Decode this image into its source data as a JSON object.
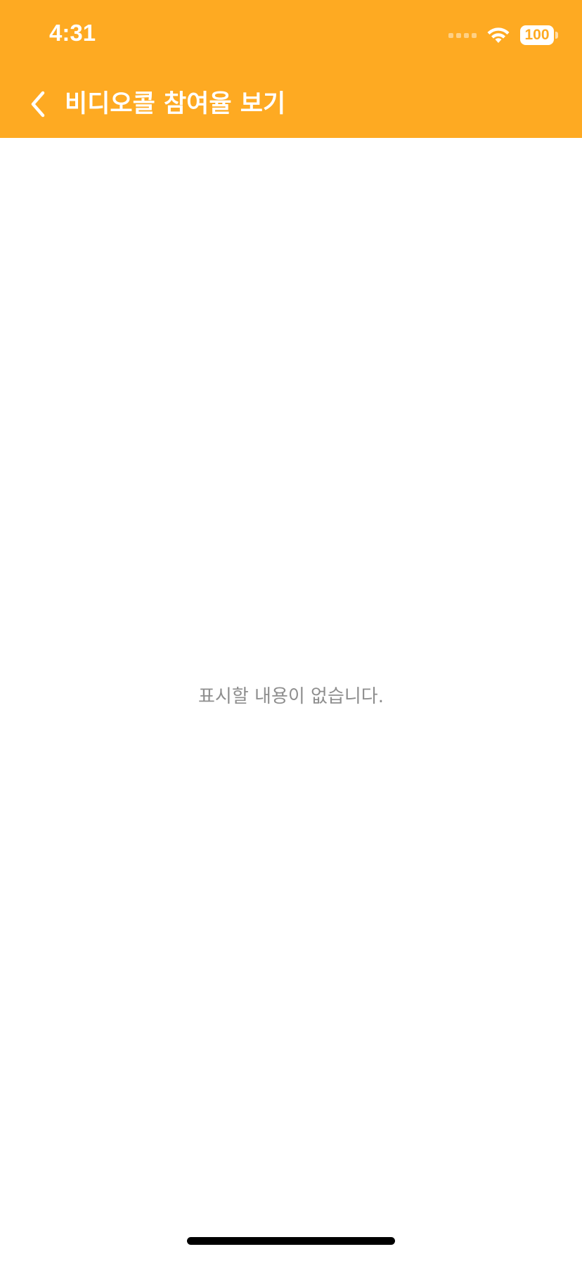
{
  "status_bar": {
    "time": "4:31",
    "battery": "100"
  },
  "nav": {
    "title": "비디오콜 참여율 보기"
  },
  "content": {
    "empty_message": "표시할 내용이 없습니다."
  },
  "colors": {
    "header": "#FEAA22",
    "background": "#FFFFFF",
    "empty_text": "#8E8E8E"
  },
  "icons": {
    "back": "chevron-left-icon",
    "wifi": "wifi-icon",
    "signal": "cellular-signal-icon",
    "battery": "battery-icon"
  }
}
